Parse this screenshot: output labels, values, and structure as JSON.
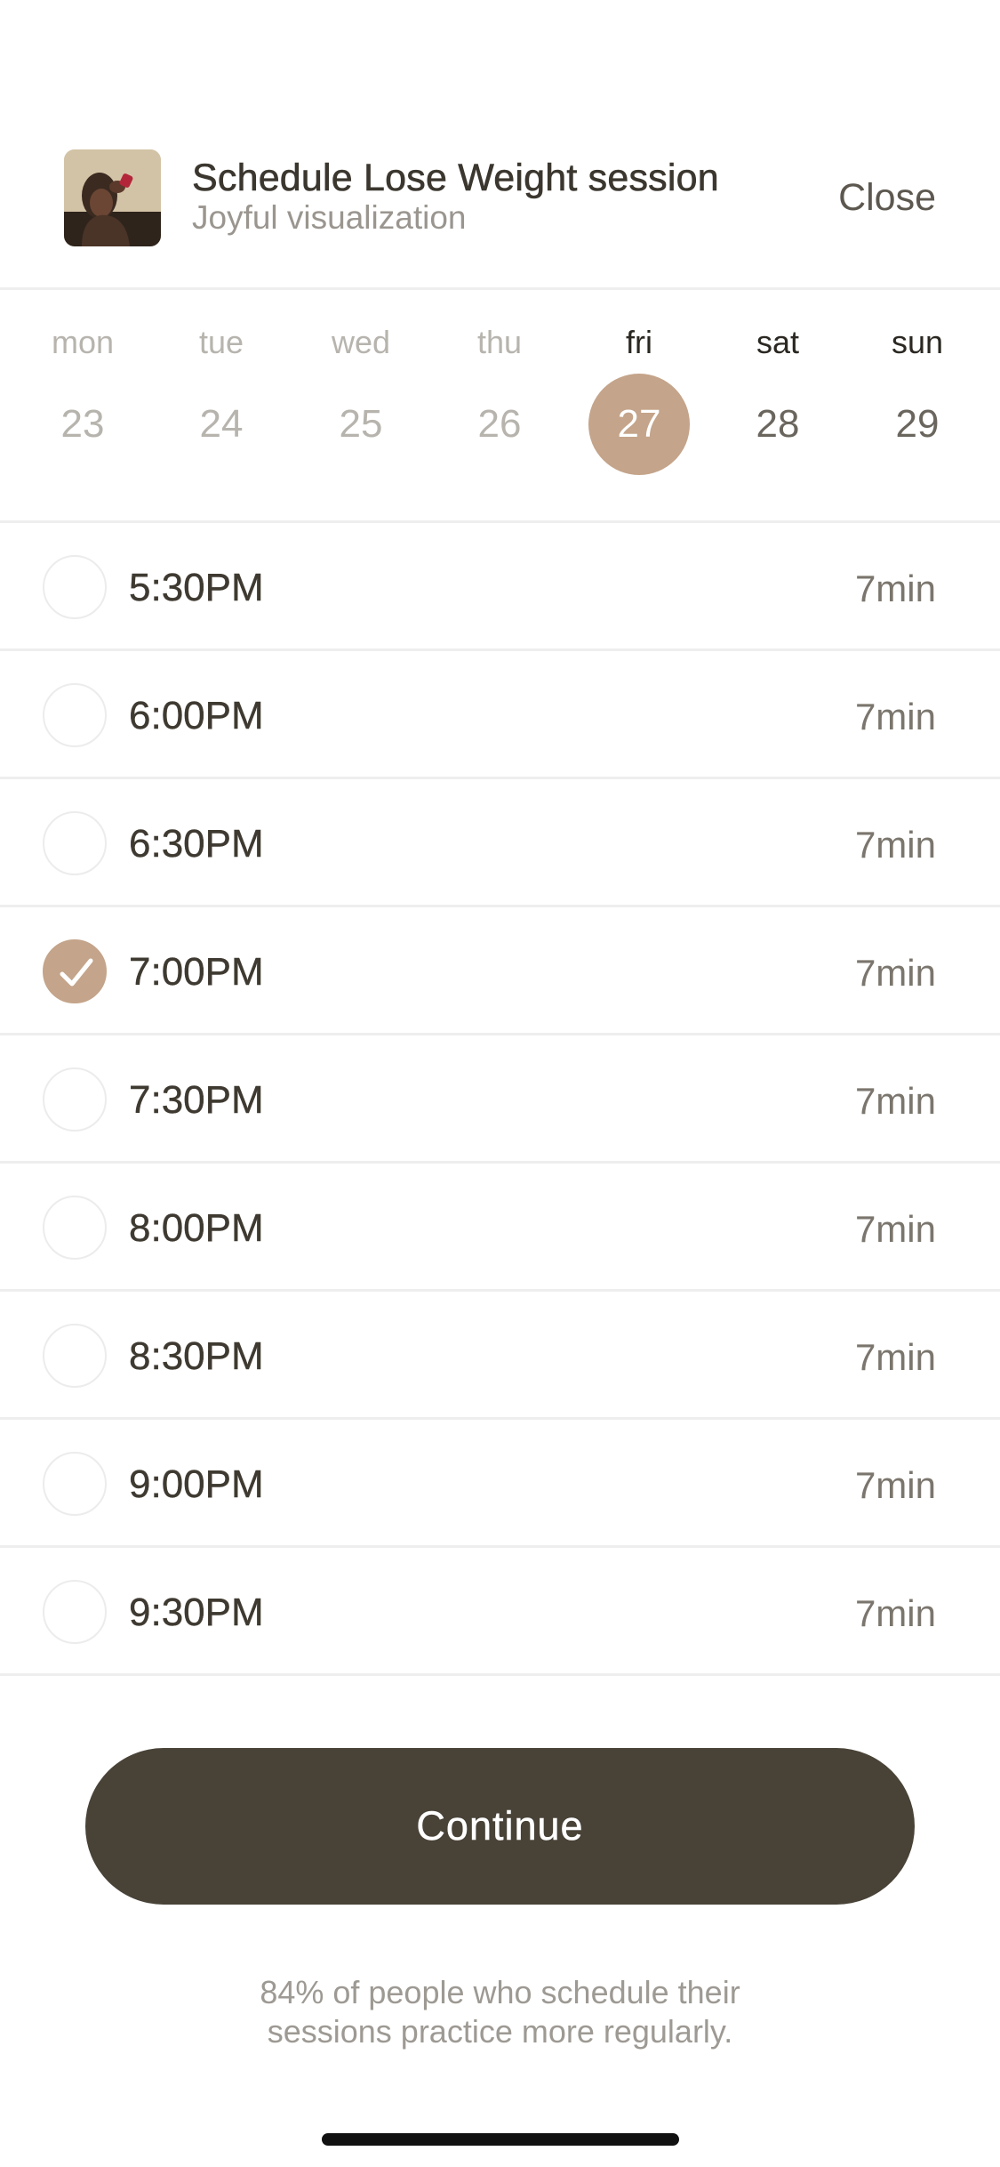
{
  "header": {
    "title": "Schedule Lose Weight session",
    "subtitle": "Joyful visualization",
    "close_label": "Close",
    "thumbnail_icon": "session-thumbnail"
  },
  "week": [
    {
      "name": "mon",
      "num": "23",
      "state": "past"
    },
    {
      "name": "tue",
      "num": "24",
      "state": "past"
    },
    {
      "name": "wed",
      "num": "25",
      "state": "past"
    },
    {
      "name": "thu",
      "num": "26",
      "state": "past"
    },
    {
      "name": "fri",
      "num": "27",
      "state": "selected"
    },
    {
      "name": "sat",
      "num": "28",
      "state": "future"
    },
    {
      "name": "sun",
      "num": "29",
      "state": "future"
    }
  ],
  "times": [
    {
      "time": "5:30PM",
      "duration": "7min",
      "checked": false
    },
    {
      "time": "6:00PM",
      "duration": "7min",
      "checked": false
    },
    {
      "time": "6:30PM",
      "duration": "7min",
      "checked": false
    },
    {
      "time": "7:00PM",
      "duration": "7min",
      "checked": true
    },
    {
      "time": "7:30PM",
      "duration": "7min",
      "checked": false
    },
    {
      "time": "8:00PM",
      "duration": "7min",
      "checked": false
    },
    {
      "time": "8:30PM",
      "duration": "7min",
      "checked": false
    },
    {
      "time": "9:00PM",
      "duration": "7min",
      "checked": false
    },
    {
      "time": "9:30PM",
      "duration": "7min",
      "checked": false
    }
  ],
  "footer": {
    "continue_label": "Continue",
    "note_line1": "84% of people who schedule their",
    "note_line2": "sessions practice more regularly."
  },
  "colors": {
    "accent": "#c4a48a",
    "button": "#484237",
    "text": "#3b372f"
  }
}
